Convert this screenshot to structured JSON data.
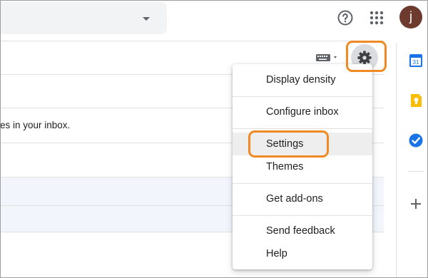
{
  "topbar": {
    "search_dropdown_icon": "caret-down-icon",
    "help_icon": "help-circle-icon",
    "apps_icon": "apps-grid-icon",
    "avatar_letter": "j",
    "avatar_color": "#6d3a2e"
  },
  "main": {
    "inbox_message": "es in your inbox.",
    "toolbar_icons": [
      "keyboard-icon",
      "gear-icon"
    ]
  },
  "settings_menu": {
    "items": [
      {
        "label": "Display density"
      },
      {
        "label": "Configure inbox"
      },
      {
        "label": "Settings"
      },
      {
        "label": "Themes"
      },
      {
        "label": "Get add-ons"
      },
      {
        "label": "Send feedback"
      },
      {
        "label": "Help"
      }
    ],
    "highlighted_item": "Settings"
  },
  "side_panel": {
    "icons": [
      "calendar-icon",
      "keep-icon",
      "tasks-icon",
      "plus-icon"
    ],
    "calendar_day": "31"
  },
  "colors": {
    "annotation": "#f08a24",
    "calendar_blue": "#1a73e8",
    "keep_yellow": "#fbbc04",
    "tasks_blue": "#1a73e8",
    "row_shade": "#f2f6fc"
  }
}
